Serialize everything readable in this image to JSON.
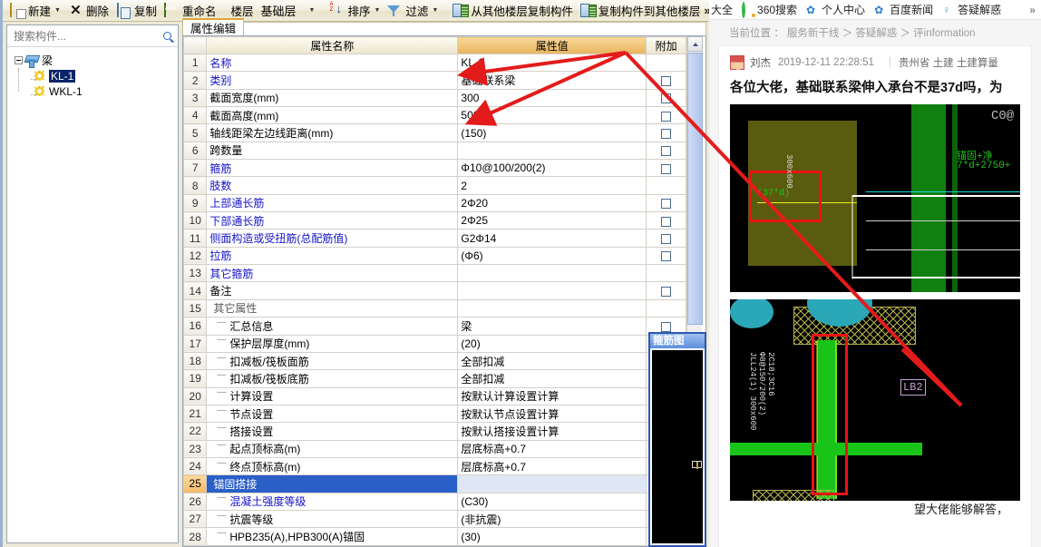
{
  "app": {
    "toolbar": {
      "items": [
        {
          "id": "new",
          "label": "新建",
          "icon": "new-icon",
          "caret": true
        },
        {
          "id": "delete",
          "label": "删除",
          "icon": "delete-x-icon",
          "caret": false
        },
        {
          "id": "copy",
          "label": "复制",
          "icon": "copy-icon",
          "caret": false
        },
        {
          "id": "rename",
          "label": "重命名",
          "icon": "rename-icon",
          "caret": false
        },
        {
          "id": "floor",
          "label": "楼层",
          "icon": "",
          "caret": false
        },
        {
          "id": "floor-select",
          "label": "基础层",
          "icon": "",
          "caret": true
        },
        {
          "id": "sort",
          "label": "排序",
          "icon": "sort-az-icon",
          "caret": true
        },
        {
          "id": "filter",
          "label": "过滤",
          "icon": "filter-icon",
          "caret": true
        },
        {
          "id": "copy-from-floor",
          "label": "从其他楼层复制构件",
          "icon": "copy-from-icon",
          "caret": false
        },
        {
          "id": "copy-to-floor",
          "label": "复制构件到其他楼层",
          "icon": "copy-to-icon",
          "caret": false
        }
      ],
      "overflow": "»"
    },
    "search": {
      "placeholder": "搜索构件...",
      "value": ""
    },
    "tree": {
      "root": {
        "label": "梁",
        "icon": "beam-icon"
      },
      "children": [
        {
          "label": "KL-1",
          "icon": "gear-icon",
          "selected": true
        },
        {
          "label": "WKL-1",
          "icon": "gear-icon",
          "selected": false
        }
      ]
    },
    "tabs": [
      {
        "label": "属性编辑",
        "active": true
      }
    ],
    "grid": {
      "headers": {
        "index": "",
        "name": "属性名称",
        "value": "属性值",
        "extra": "附加"
      },
      "rows": [
        {
          "idx": "1",
          "name": "名称",
          "value": "KL-1",
          "indent": 0,
          "style": "blue",
          "checkbox": false,
          "group": false
        },
        {
          "idx": "2",
          "name": "类别",
          "value": "基础联系梁",
          "indent": 0,
          "style": "blue",
          "checkbox": true,
          "group": false
        },
        {
          "idx": "3",
          "name": "截面宽度(mm)",
          "value": "300",
          "indent": 0,
          "style": "black",
          "checkbox": true,
          "group": false
        },
        {
          "idx": "4",
          "name": "截面高度(mm)",
          "value": "500",
          "indent": 0,
          "style": "black",
          "checkbox": true,
          "group": false
        },
        {
          "idx": "5",
          "name": "轴线距梁左边线距离(mm)",
          "value": "(150)",
          "indent": 0,
          "style": "black",
          "checkbox": true,
          "group": false
        },
        {
          "idx": "6",
          "name": "跨数量",
          "value": "",
          "indent": 0,
          "style": "black",
          "checkbox": true,
          "group": false
        },
        {
          "idx": "7",
          "name": "箍筋",
          "value": "Φ10@100/200(2)",
          "indent": 0,
          "style": "blue",
          "checkbox": true,
          "group": false
        },
        {
          "idx": "8",
          "name": "肢数",
          "value": "2",
          "indent": 0,
          "style": "blue",
          "checkbox": false,
          "group": false
        },
        {
          "idx": "9",
          "name": "上部通长筋",
          "value": "2Φ20",
          "indent": 0,
          "style": "blue",
          "checkbox": true,
          "group": false
        },
        {
          "idx": "10",
          "name": "下部通长筋",
          "value": "2Φ25",
          "indent": 0,
          "style": "blue",
          "checkbox": true,
          "group": false
        },
        {
          "idx": "11",
          "name": "侧面构造或受扭筋(总配筋值)",
          "value": "G2Φ14",
          "indent": 0,
          "style": "blue",
          "checkbox": true,
          "group": false
        },
        {
          "idx": "12",
          "name": "拉筋",
          "value": "(Φ6)",
          "indent": 0,
          "style": "blue",
          "checkbox": true,
          "group": false
        },
        {
          "idx": "13",
          "name": "其它箍筋",
          "value": "",
          "indent": 0,
          "style": "blue",
          "checkbox": false,
          "group": false
        },
        {
          "idx": "14",
          "name": "备注",
          "value": "",
          "indent": 0,
          "style": "black",
          "checkbox": true,
          "group": false
        },
        {
          "idx": "15",
          "name": "其它属性",
          "value": "",
          "indent": 0,
          "style": "gray",
          "checkbox": false,
          "group": true
        },
        {
          "idx": "16",
          "name": "汇总信息",
          "value": "梁",
          "indent": 1,
          "style": "black",
          "checkbox": true,
          "group": false
        },
        {
          "idx": "17",
          "name": "保护层厚度(mm)",
          "value": "(20)",
          "indent": 1,
          "style": "black",
          "checkbox": true,
          "group": false
        },
        {
          "idx": "18",
          "name": "扣减板/筏板面筋",
          "value": "全部扣减",
          "indent": 1,
          "style": "black",
          "checkbox": true,
          "group": false
        },
        {
          "idx": "19",
          "name": "扣减板/筏板底筋",
          "value": "全部扣减",
          "indent": 1,
          "style": "black",
          "checkbox": true,
          "group": false
        },
        {
          "idx": "20",
          "name": "计算设置",
          "value": "按默认计算设置计算",
          "indent": 1,
          "style": "black",
          "checkbox": false,
          "group": false
        },
        {
          "idx": "21",
          "name": "节点设置",
          "value": "按默认节点设置计算",
          "indent": 1,
          "style": "black",
          "checkbox": false,
          "group": false
        },
        {
          "idx": "22",
          "name": "搭接设置",
          "value": "按默认搭接设置计算",
          "indent": 1,
          "style": "black",
          "checkbox": false,
          "group": false
        },
        {
          "idx": "23",
          "name": "起点顶标高(m)",
          "value": "层底标高+0.7",
          "indent": 1,
          "style": "black",
          "checkbox": true,
          "group": false
        },
        {
          "idx": "24",
          "name": "终点顶标高(m)",
          "value": "层底标高+0.7",
          "indent": 1,
          "style": "black",
          "checkbox": true,
          "group": false
        },
        {
          "idx": "25",
          "name": "锚固搭接",
          "value": "",
          "indent": 0,
          "style": "white",
          "checkbox": false,
          "group": true,
          "selected": true
        },
        {
          "idx": "26",
          "name": "混凝土强度等级",
          "value": "(C30)",
          "indent": 1,
          "style": "blue",
          "checkbox": true,
          "group": false
        },
        {
          "idx": "27",
          "name": "抗震等级",
          "value": "(非抗震)",
          "indent": 1,
          "style": "black",
          "checkbox": true,
          "group": false
        },
        {
          "idx": "28",
          "name": "HPB235(A),HPB300(A)锚固",
          "value": "(30)",
          "indent": 1,
          "style": "black",
          "checkbox": false,
          "group": false
        }
      ]
    },
    "stirrup_panel": {
      "title": "箍筋图"
    }
  },
  "browser": {
    "bookmarks": [
      {
        "label": "大全",
        "icon": ""
      },
      {
        "label": "360搜索",
        "icon": "360-circle-icon"
      },
      {
        "label": "个人中心",
        "icon": "paw-icon"
      },
      {
        "label": "百度新闻",
        "icon": "paw-icon"
      },
      {
        "label": "答疑解惑",
        "icon": "bulb-icon"
      }
    ],
    "bookmarks_overflow": "»",
    "breadcrumb": "当前位置 :  服务新干线 > 答疑解惑 > 评information",
    "breadcrumb_text": "当前位置 ：  服务新干线 ＞ 答疑解惑 ＞ 评information",
    "post": {
      "author": "刘杰",
      "datetime": "2019-12-11 22:28:51",
      "divider": "|",
      "tags": "贵州省 土建 土建算量",
      "title": "各位大佬，基础联系梁伸入承台不是37d吗，为",
      "image1_labels": {
        "red_label": "(37*d)",
        "green_note1": "锚固+净",
        "green_note2": "7*d+2750+"
      },
      "image2_labels": {
        "spec": "JLL24(1) 300x600",
        "spec2": "Φ8@150/200(2)",
        "spec3": "2C18;3C16",
        "tag": "LB2"
      },
      "reply_text": "望大佬能够解答，"
    }
  }
}
